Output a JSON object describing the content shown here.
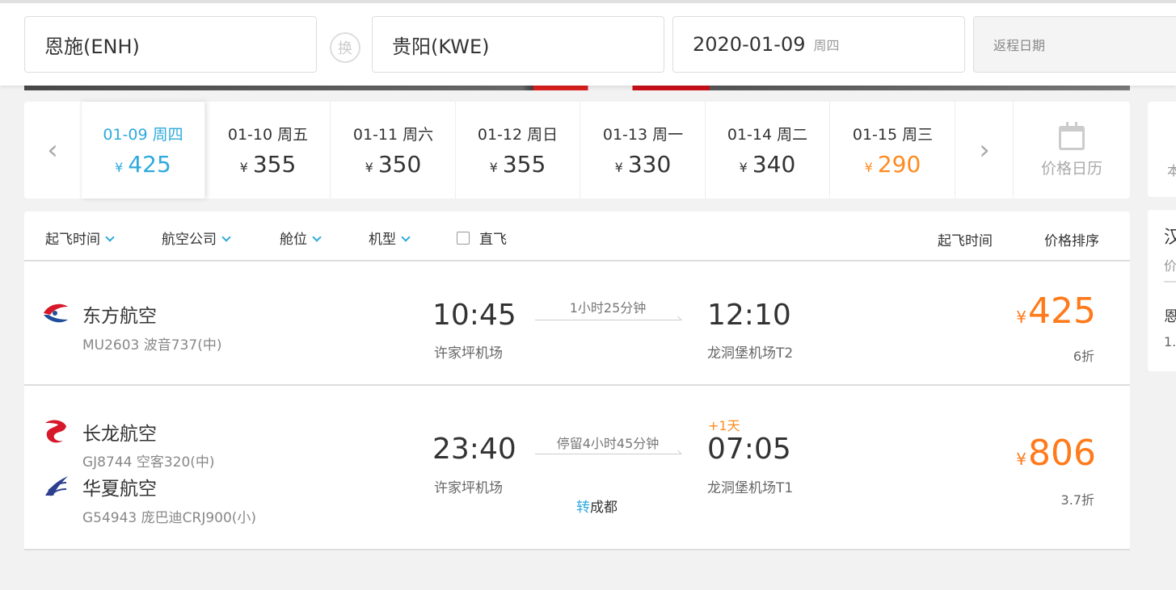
{
  "search": {
    "from": "恩施(ENH)",
    "to": "贵阳(KWE)",
    "swap_label": "换",
    "date": "2020-01-09",
    "weekday": "周四",
    "return_placeholder": "返程日期"
  },
  "date_strip": {
    "currency": "¥",
    "items": [
      {
        "date": "01-09 周四",
        "price": "425",
        "state": "active"
      },
      {
        "date": "01-10 周五",
        "price": "355",
        "state": "normal"
      },
      {
        "date": "01-11 周六",
        "price": "350",
        "state": "normal"
      },
      {
        "date": "01-12 周日",
        "price": "355",
        "state": "normal"
      },
      {
        "date": "01-13 周一",
        "price": "330",
        "state": "normal"
      },
      {
        "date": "01-14 周二",
        "price": "340",
        "state": "normal"
      },
      {
        "date": "01-15 周三",
        "price": "290",
        "state": "lowest"
      }
    ],
    "calendar_label": "价格日历"
  },
  "side": {
    "top_text": "本",
    "box_title": "汉",
    "box_sub": "价",
    "box_city": "恩",
    "box_val": "1."
  },
  "filters": {
    "departure_time": "起飞时间",
    "airline": "航空公司",
    "cabin": "舱位",
    "aircraft": "机型",
    "direct": "直飞",
    "sort_time": "起飞时间",
    "sort_price": "价格排序"
  },
  "flights": [
    {
      "airline": "东方航空",
      "info": "MU2603 波音737(中)",
      "dep_time": "10:45",
      "dep_airport": "许家坪机场",
      "duration": "1小时25分钟",
      "arr_time": "12:10",
      "arr_airport": "龙洞堡机场T2",
      "currency": "¥",
      "price": "425",
      "discount": "6折"
    },
    {
      "airline": "长龙航空",
      "info": "GJ8744 空客320(中)",
      "airline2": "华夏航空",
      "info2": "G54943 庞巴迪CRJ900(小)",
      "dep_time": "23:40",
      "dep_airport": "许家坪机场",
      "duration": "停留4小时45分钟",
      "plus_day": "+1天",
      "arr_time": "07:05",
      "arr_airport": "龙洞堡机场T1",
      "transfer_prefix": "转",
      "transfer_city": "成都",
      "currency": "¥",
      "price": "806",
      "discount": "3.7折"
    }
  ],
  "colors": {
    "accent": "#2eaadc",
    "price": "#ff7a1a"
  }
}
